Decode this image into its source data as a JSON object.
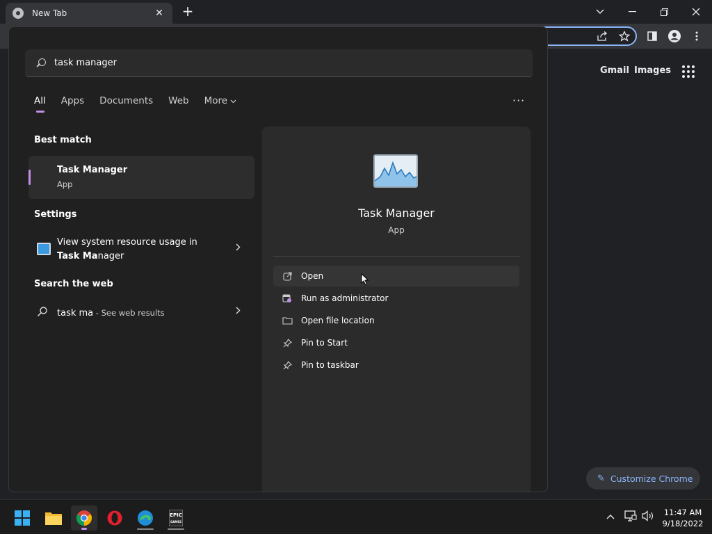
{
  "browser": {
    "tab_title": "New Tab",
    "tab_close": "✕",
    "new_tab": "+",
    "ntp_links": [
      "Gmail",
      "Images"
    ],
    "customize_label": "Customize Chrome"
  },
  "search": {
    "query": "task manager",
    "filters": [
      "All",
      "Apps",
      "Documents",
      "Web",
      "More"
    ],
    "more_dots": "···",
    "sections": {
      "best_match": "Best match",
      "settings": "Settings",
      "web": "Search the web"
    },
    "best_match": {
      "name": "Task Manager",
      "type": "App"
    },
    "settings_item": {
      "line1": "View system resource usage in",
      "line2_bold": "Task Ma",
      "line2_rest": "nager"
    },
    "web_item": {
      "query": "task ma",
      "suffix": " - See web results"
    }
  },
  "preview": {
    "name": "Task Manager",
    "type": "App",
    "actions": [
      "Open",
      "Run as administrator",
      "Open file location",
      "Pin to Start",
      "Pin to taskbar"
    ]
  },
  "taskbar": {
    "time": "11:47 AM",
    "date": "9/18/2022",
    "epic_label_1": "EPIC",
    "epic_label_2": "GAMES"
  },
  "colors": {
    "accent": "#c48fe6",
    "chrome_link": "#8ab4f8",
    "focus_ring": "#8ab4f8"
  }
}
